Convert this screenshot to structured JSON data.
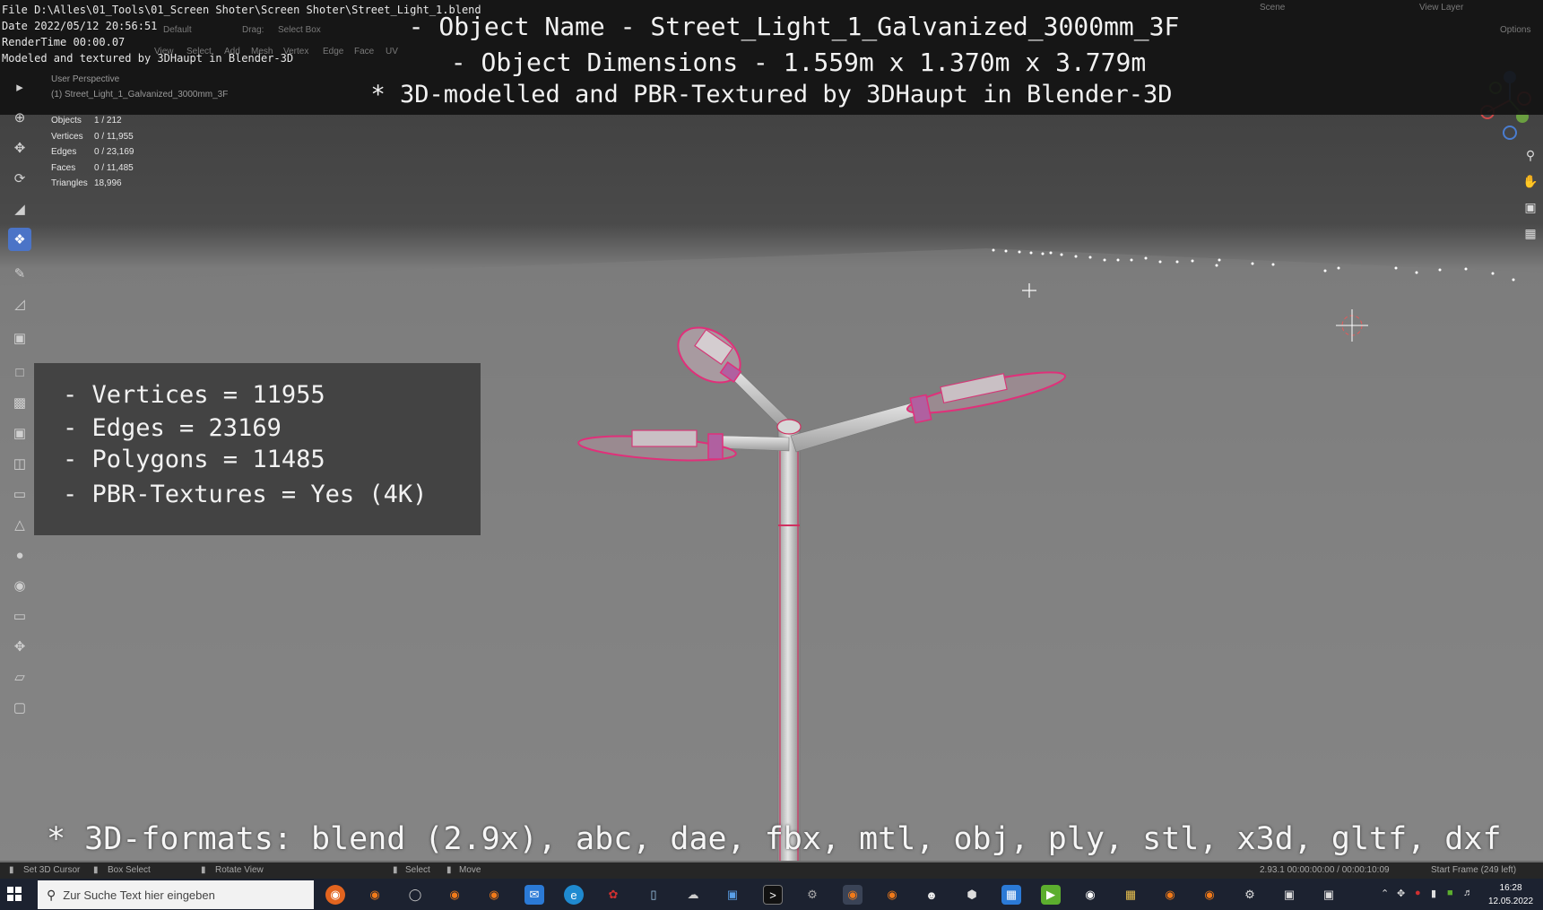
{
  "file_info": {
    "file": "File D:\\Alles\\01_Tools\\01_Screen Shoter\\Screen Shoter\\Street_Light_1.blend",
    "date": "Date 2022/05/12 20:56:51",
    "render_time": "RenderTime 00:00.07",
    "credit": "Modeled and textured by 3DHaupt in Blender-3D"
  },
  "headline": {
    "object_name": "- Object Name - Street_Light_1_Galvanized_3000mm_3F",
    "dimensions": "- Object Dimensions -  1.559m x 1.370m x 3.779m",
    "modelled_by": "* 3D-modelled and PBR-Textured by 3DHaupt in Blender-3D"
  },
  "header_faint": {
    "layout": "Default",
    "drag_label": "Drag:",
    "drag_value": "Select Box",
    "menus": [
      "View",
      "Select",
      "Add",
      "Mesh",
      "Vertex",
      "Edge",
      "Face",
      "UV"
    ],
    "scene": "Scene",
    "view_layer": "View Layer",
    "options": "Options"
  },
  "viewport": {
    "perspective": "User Perspective",
    "object_label": "(1) Street_Light_1_Galvanized_3000mm_3F"
  },
  "stats": [
    {
      "key": "Objects",
      "value": "1 / 212"
    },
    {
      "key": "Vertices",
      "value": "0 / 11,955"
    },
    {
      "key": "Edges",
      "value": "0 / 23,169"
    },
    {
      "key": "Faces",
      "value": "0 / 11,485"
    },
    {
      "key": "Triangles",
      "value": "18,996"
    }
  ],
  "infobox": {
    "vertices": "- Vertices = 11955",
    "edges": "- Edges = 23169",
    "polygons": "- Polygons = 11485",
    "textures": "- PBR-Textures =  Yes (4K)"
  },
  "formats": "* 3D-formats: blend (2.9x), abc, dae, fbx, mtl, obj, ply, stl, x3d, gltf, dxf",
  "statusbar": {
    "set_cursor": "Set 3D Cursor",
    "box_select": "Box Select",
    "rotate_view": "Rotate View",
    "select": "Select",
    "move": "Move",
    "version_time": "2.93.1  00:00:00:00 / 00:00:10:09",
    "start_frame": "Start Frame (249 left)"
  },
  "taskbar": {
    "search_placeholder": "Zur Suche Text hier eingeben",
    "time": "16:28",
    "date": "12.05.2022"
  },
  "colors": {
    "wire_highlight": "#e0307a",
    "active_tool": "#4b74c7"
  }
}
